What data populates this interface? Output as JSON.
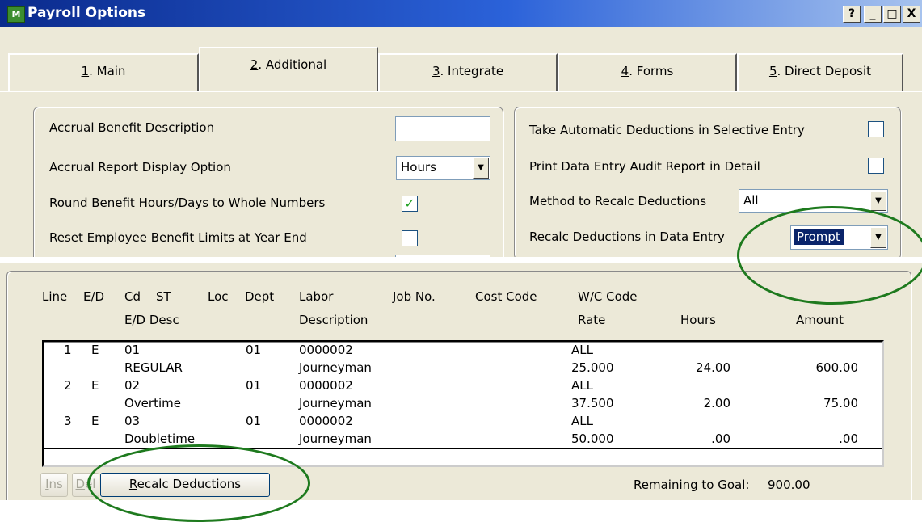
{
  "window": {
    "title": "Payroll Options",
    "app_icon_text": "M",
    "help_btn": "?",
    "minimize_btn": "_",
    "maximize_btn": "□",
    "close_btn": "X"
  },
  "tabs": [
    {
      "num": "1",
      "rest": ". Main"
    },
    {
      "num": "2",
      "rest": ". Additional"
    },
    {
      "num": "3",
      "rest": ". Integrate"
    },
    {
      "num": "4",
      "rest": ". Forms"
    },
    {
      "num": "5",
      "rest": ". Direct Deposit"
    }
  ],
  "left_group": {
    "accrual_desc_label": "Accrual Benefit Description",
    "accrual_desc_value": "",
    "accrual_display_label": "Accrual Report Display Option",
    "accrual_display_value": "Hours",
    "round_label": "Round Benefit Hours/Days to Whole Numbers",
    "round_check": "✓",
    "reset_label": "Reset Employee Benefit Limits at Year End"
  },
  "right_group": {
    "auto_ded_label": "Take Automatic Deductions in Selective Entry",
    "print_audit_label": "Print Data Entry Audit Report in Detail",
    "method_label": "Method to Recalc Deductions",
    "method_value": "All",
    "recalc_label": "Recalc Deductions in Data Entry",
    "recalc_value": "Prompt"
  },
  "grid": {
    "headers": {
      "line": "Line",
      "ed": "E/D",
      "cd": "Cd",
      "st": "ST",
      "loc": "Loc",
      "dept": "Dept",
      "labor": "Labor",
      "job": "Job No.",
      "cost": "Cost Code",
      "wc": "W/C Code",
      "ed_desc": "E/D Desc",
      "description": "Description",
      "rate": "Rate",
      "hours": "Hours",
      "amount": "Amount"
    },
    "rows": [
      {
        "line": "1",
        "ed": "E",
        "cd": "01",
        "dept": "01",
        "labor": "0000002",
        "wc": "ALL",
        "desc": "REGULAR",
        "labor_desc": "Journeyman",
        "rate": "25.000",
        "hours": "24.00",
        "amount": "600.00"
      },
      {
        "line": "2",
        "ed": "E",
        "cd": "02",
        "dept": "01",
        "labor": "0000002",
        "wc": "ALL",
        "desc": "Overtime",
        "labor_desc": "Journeyman",
        "rate": "37.500",
        "hours": "2.00",
        "amount": "75.00"
      },
      {
        "line": "3",
        "ed": "E",
        "cd": "03",
        "dept": "01",
        "labor": "0000002",
        "wc": "ALL",
        "desc": "Doubletime",
        "labor_desc": "Journeyman",
        "rate": "50.000",
        "hours": ".00",
        "amount": ".00"
      }
    ]
  },
  "footer": {
    "ins_u": "I",
    "ins_rest": "ns",
    "del_u": "D",
    "del_rest": "el",
    "recalc_u": "R",
    "recalc_rest": "ecalc Deductions",
    "remaining_label": "Remaining to Goal:",
    "remaining_value": "900.00"
  }
}
